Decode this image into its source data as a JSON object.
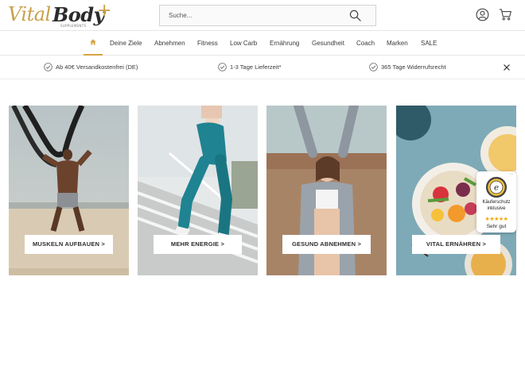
{
  "logo": {
    "vital": "Vital",
    "body": "Body",
    "plus": "+",
    "tagline": "SUPPLEMENTS"
  },
  "search": {
    "placeholder": "Suche..."
  },
  "header_icons": [
    "account-icon",
    "cart-icon"
  ],
  "nav": {
    "home_icon": "home-icon",
    "items": [
      "Deine Ziele",
      "Abnehmen",
      "Fitness",
      "Low Carb",
      "Ernährung",
      "Gesundheit",
      "Coach",
      "Marken",
      "SALE"
    ]
  },
  "usp": {
    "items": [
      "Ab 40€ Versandkostenfrei (DE)",
      "1-3 Tage Lieferzeit*",
      "365 Tage Widerrufsrecht"
    ],
    "close_icon": "close-icon"
  },
  "tiles": [
    {
      "label": "MUSKELN AUFBAUEN >"
    },
    {
      "label": "MEHR ENERGIE >"
    },
    {
      "label": "GESUND ABNEHMEN >"
    },
    {
      "label": "VITAL ERNÄHREN >"
    }
  ],
  "trust_badge": {
    "line1": "Käuferschutz",
    "line2": "inklusive",
    "stars": "★★★★★",
    "rating": "Sehr gut",
    "menu": "···"
  },
  "colors": {
    "accent": "#d9a441",
    "logo_gold": "#c9a04a",
    "star": "#f2a900"
  }
}
